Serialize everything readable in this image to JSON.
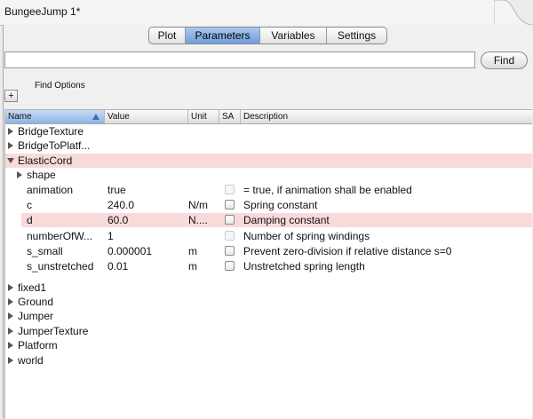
{
  "document": {
    "title": "BungeeJump 1*"
  },
  "tabs": [
    {
      "label": "Plot",
      "active": false
    },
    {
      "label": "Parameters",
      "active": true
    },
    {
      "label": "Variables",
      "active": false
    },
    {
      "label": "Settings",
      "active": false
    }
  ],
  "search": {
    "value": "",
    "placeholder": "",
    "find_label": "Find"
  },
  "find_options": {
    "label": "Find Options",
    "add_label": "+"
  },
  "table": {
    "columns": {
      "name": "Name",
      "value": "Value",
      "unit": "Unit",
      "sa": "SA",
      "description": "Description"
    },
    "sorted_by": "Name",
    "rows": [
      {
        "name": "BridgeTexture",
        "value": "",
        "unit": "",
        "desc": "",
        "expander": "collapsed"
      },
      {
        "name": "BridgeToPlatf...",
        "value": "",
        "unit": "",
        "desc": "",
        "expander": "collapsed"
      },
      {
        "name": "ElasticCord",
        "value": "",
        "unit": "",
        "desc": "",
        "expander": "expanded"
      },
      {
        "name": "shape",
        "value": "",
        "unit": "",
        "desc": "",
        "expander": "collapsed"
      },
      {
        "name": "animation",
        "value": "true",
        "unit": "",
        "desc": "= true, if animation shall be enabled"
      },
      {
        "name": "c",
        "value": "240.0",
        "unit": "N/m",
        "desc": "Spring constant"
      },
      {
        "name": "d",
        "value": "60.0",
        "unit": "N....",
        "desc": "Damping constant"
      },
      {
        "name": "numberOfW...",
        "value": "1",
        "unit": "",
        "desc": "Number of spring windings"
      },
      {
        "name": "s_small",
        "value": "0.000001",
        "unit": "m",
        "desc": "Prevent zero-division if relative distance s=0"
      },
      {
        "name": "s_unstretched",
        "value": "0.01",
        "unit": "m",
        "desc": "Unstretched spring length"
      },
      {
        "name": "fixed1",
        "value": "",
        "unit": "",
        "desc": "",
        "expander": "collapsed"
      },
      {
        "name": "Ground",
        "value": "",
        "unit": "",
        "desc": "",
        "expander": "collapsed"
      },
      {
        "name": "Jumper",
        "value": "",
        "unit": "",
        "desc": "",
        "expander": "collapsed"
      },
      {
        "name": "JumperTexture",
        "value": "",
        "unit": "",
        "desc": "",
        "expander": "collapsed"
      },
      {
        "name": "Platform",
        "value": "",
        "unit": "",
        "desc": "",
        "expander": "collapsed"
      },
      {
        "name": "world",
        "value": "",
        "unit": "",
        "desc": "",
        "expander": "collapsed"
      }
    ]
  },
  "colors": {
    "highlight_row": "#f9dada",
    "active_tab": "#7aa7e0"
  }
}
